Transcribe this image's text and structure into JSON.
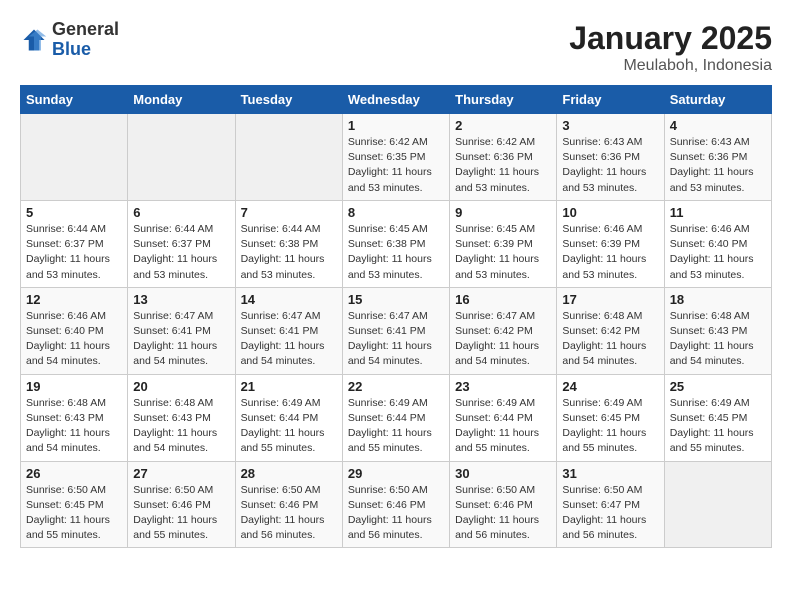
{
  "header": {
    "logo_general": "General",
    "logo_blue": "Blue",
    "title": "January 2025",
    "subtitle": "Meulaboh, Indonesia"
  },
  "weekdays": [
    "Sunday",
    "Monday",
    "Tuesday",
    "Wednesday",
    "Thursday",
    "Friday",
    "Saturday"
  ],
  "weeks": [
    [
      {
        "day": "",
        "sunrise": "",
        "sunset": "",
        "daylight": ""
      },
      {
        "day": "",
        "sunrise": "",
        "sunset": "",
        "daylight": ""
      },
      {
        "day": "",
        "sunrise": "",
        "sunset": "",
        "daylight": ""
      },
      {
        "day": "1",
        "sunrise": "Sunrise: 6:42 AM",
        "sunset": "Sunset: 6:35 PM",
        "daylight": "Daylight: 11 hours and 53 minutes."
      },
      {
        "day": "2",
        "sunrise": "Sunrise: 6:42 AM",
        "sunset": "Sunset: 6:36 PM",
        "daylight": "Daylight: 11 hours and 53 minutes."
      },
      {
        "day": "3",
        "sunrise": "Sunrise: 6:43 AM",
        "sunset": "Sunset: 6:36 PM",
        "daylight": "Daylight: 11 hours and 53 minutes."
      },
      {
        "day": "4",
        "sunrise": "Sunrise: 6:43 AM",
        "sunset": "Sunset: 6:36 PM",
        "daylight": "Daylight: 11 hours and 53 minutes."
      }
    ],
    [
      {
        "day": "5",
        "sunrise": "Sunrise: 6:44 AM",
        "sunset": "Sunset: 6:37 PM",
        "daylight": "Daylight: 11 hours and 53 minutes."
      },
      {
        "day": "6",
        "sunrise": "Sunrise: 6:44 AM",
        "sunset": "Sunset: 6:37 PM",
        "daylight": "Daylight: 11 hours and 53 minutes."
      },
      {
        "day": "7",
        "sunrise": "Sunrise: 6:44 AM",
        "sunset": "Sunset: 6:38 PM",
        "daylight": "Daylight: 11 hours and 53 minutes."
      },
      {
        "day": "8",
        "sunrise": "Sunrise: 6:45 AM",
        "sunset": "Sunset: 6:38 PM",
        "daylight": "Daylight: 11 hours and 53 minutes."
      },
      {
        "day": "9",
        "sunrise": "Sunrise: 6:45 AM",
        "sunset": "Sunset: 6:39 PM",
        "daylight": "Daylight: 11 hours and 53 minutes."
      },
      {
        "day": "10",
        "sunrise": "Sunrise: 6:46 AM",
        "sunset": "Sunset: 6:39 PM",
        "daylight": "Daylight: 11 hours and 53 minutes."
      },
      {
        "day": "11",
        "sunrise": "Sunrise: 6:46 AM",
        "sunset": "Sunset: 6:40 PM",
        "daylight": "Daylight: 11 hours and 53 minutes."
      }
    ],
    [
      {
        "day": "12",
        "sunrise": "Sunrise: 6:46 AM",
        "sunset": "Sunset: 6:40 PM",
        "daylight": "Daylight: 11 hours and 54 minutes."
      },
      {
        "day": "13",
        "sunrise": "Sunrise: 6:47 AM",
        "sunset": "Sunset: 6:41 PM",
        "daylight": "Daylight: 11 hours and 54 minutes."
      },
      {
        "day": "14",
        "sunrise": "Sunrise: 6:47 AM",
        "sunset": "Sunset: 6:41 PM",
        "daylight": "Daylight: 11 hours and 54 minutes."
      },
      {
        "day": "15",
        "sunrise": "Sunrise: 6:47 AM",
        "sunset": "Sunset: 6:41 PM",
        "daylight": "Daylight: 11 hours and 54 minutes."
      },
      {
        "day": "16",
        "sunrise": "Sunrise: 6:47 AM",
        "sunset": "Sunset: 6:42 PM",
        "daylight": "Daylight: 11 hours and 54 minutes."
      },
      {
        "day": "17",
        "sunrise": "Sunrise: 6:48 AM",
        "sunset": "Sunset: 6:42 PM",
        "daylight": "Daylight: 11 hours and 54 minutes."
      },
      {
        "day": "18",
        "sunrise": "Sunrise: 6:48 AM",
        "sunset": "Sunset: 6:43 PM",
        "daylight": "Daylight: 11 hours and 54 minutes."
      }
    ],
    [
      {
        "day": "19",
        "sunrise": "Sunrise: 6:48 AM",
        "sunset": "Sunset: 6:43 PM",
        "daylight": "Daylight: 11 hours and 54 minutes."
      },
      {
        "day": "20",
        "sunrise": "Sunrise: 6:48 AM",
        "sunset": "Sunset: 6:43 PM",
        "daylight": "Daylight: 11 hours and 54 minutes."
      },
      {
        "day": "21",
        "sunrise": "Sunrise: 6:49 AM",
        "sunset": "Sunset: 6:44 PM",
        "daylight": "Daylight: 11 hours and 55 minutes."
      },
      {
        "day": "22",
        "sunrise": "Sunrise: 6:49 AM",
        "sunset": "Sunset: 6:44 PM",
        "daylight": "Daylight: 11 hours and 55 minutes."
      },
      {
        "day": "23",
        "sunrise": "Sunrise: 6:49 AM",
        "sunset": "Sunset: 6:44 PM",
        "daylight": "Daylight: 11 hours and 55 minutes."
      },
      {
        "day": "24",
        "sunrise": "Sunrise: 6:49 AM",
        "sunset": "Sunset: 6:45 PM",
        "daylight": "Daylight: 11 hours and 55 minutes."
      },
      {
        "day": "25",
        "sunrise": "Sunrise: 6:49 AM",
        "sunset": "Sunset: 6:45 PM",
        "daylight": "Daylight: 11 hours and 55 minutes."
      }
    ],
    [
      {
        "day": "26",
        "sunrise": "Sunrise: 6:50 AM",
        "sunset": "Sunset: 6:45 PM",
        "daylight": "Daylight: 11 hours and 55 minutes."
      },
      {
        "day": "27",
        "sunrise": "Sunrise: 6:50 AM",
        "sunset": "Sunset: 6:46 PM",
        "daylight": "Daylight: 11 hours and 55 minutes."
      },
      {
        "day": "28",
        "sunrise": "Sunrise: 6:50 AM",
        "sunset": "Sunset: 6:46 PM",
        "daylight": "Daylight: 11 hours and 56 minutes."
      },
      {
        "day": "29",
        "sunrise": "Sunrise: 6:50 AM",
        "sunset": "Sunset: 6:46 PM",
        "daylight": "Daylight: 11 hours and 56 minutes."
      },
      {
        "day": "30",
        "sunrise": "Sunrise: 6:50 AM",
        "sunset": "Sunset: 6:46 PM",
        "daylight": "Daylight: 11 hours and 56 minutes."
      },
      {
        "day": "31",
        "sunrise": "Sunrise: 6:50 AM",
        "sunset": "Sunset: 6:47 PM",
        "daylight": "Daylight: 11 hours and 56 minutes."
      },
      {
        "day": "",
        "sunrise": "",
        "sunset": "",
        "daylight": ""
      }
    ]
  ]
}
